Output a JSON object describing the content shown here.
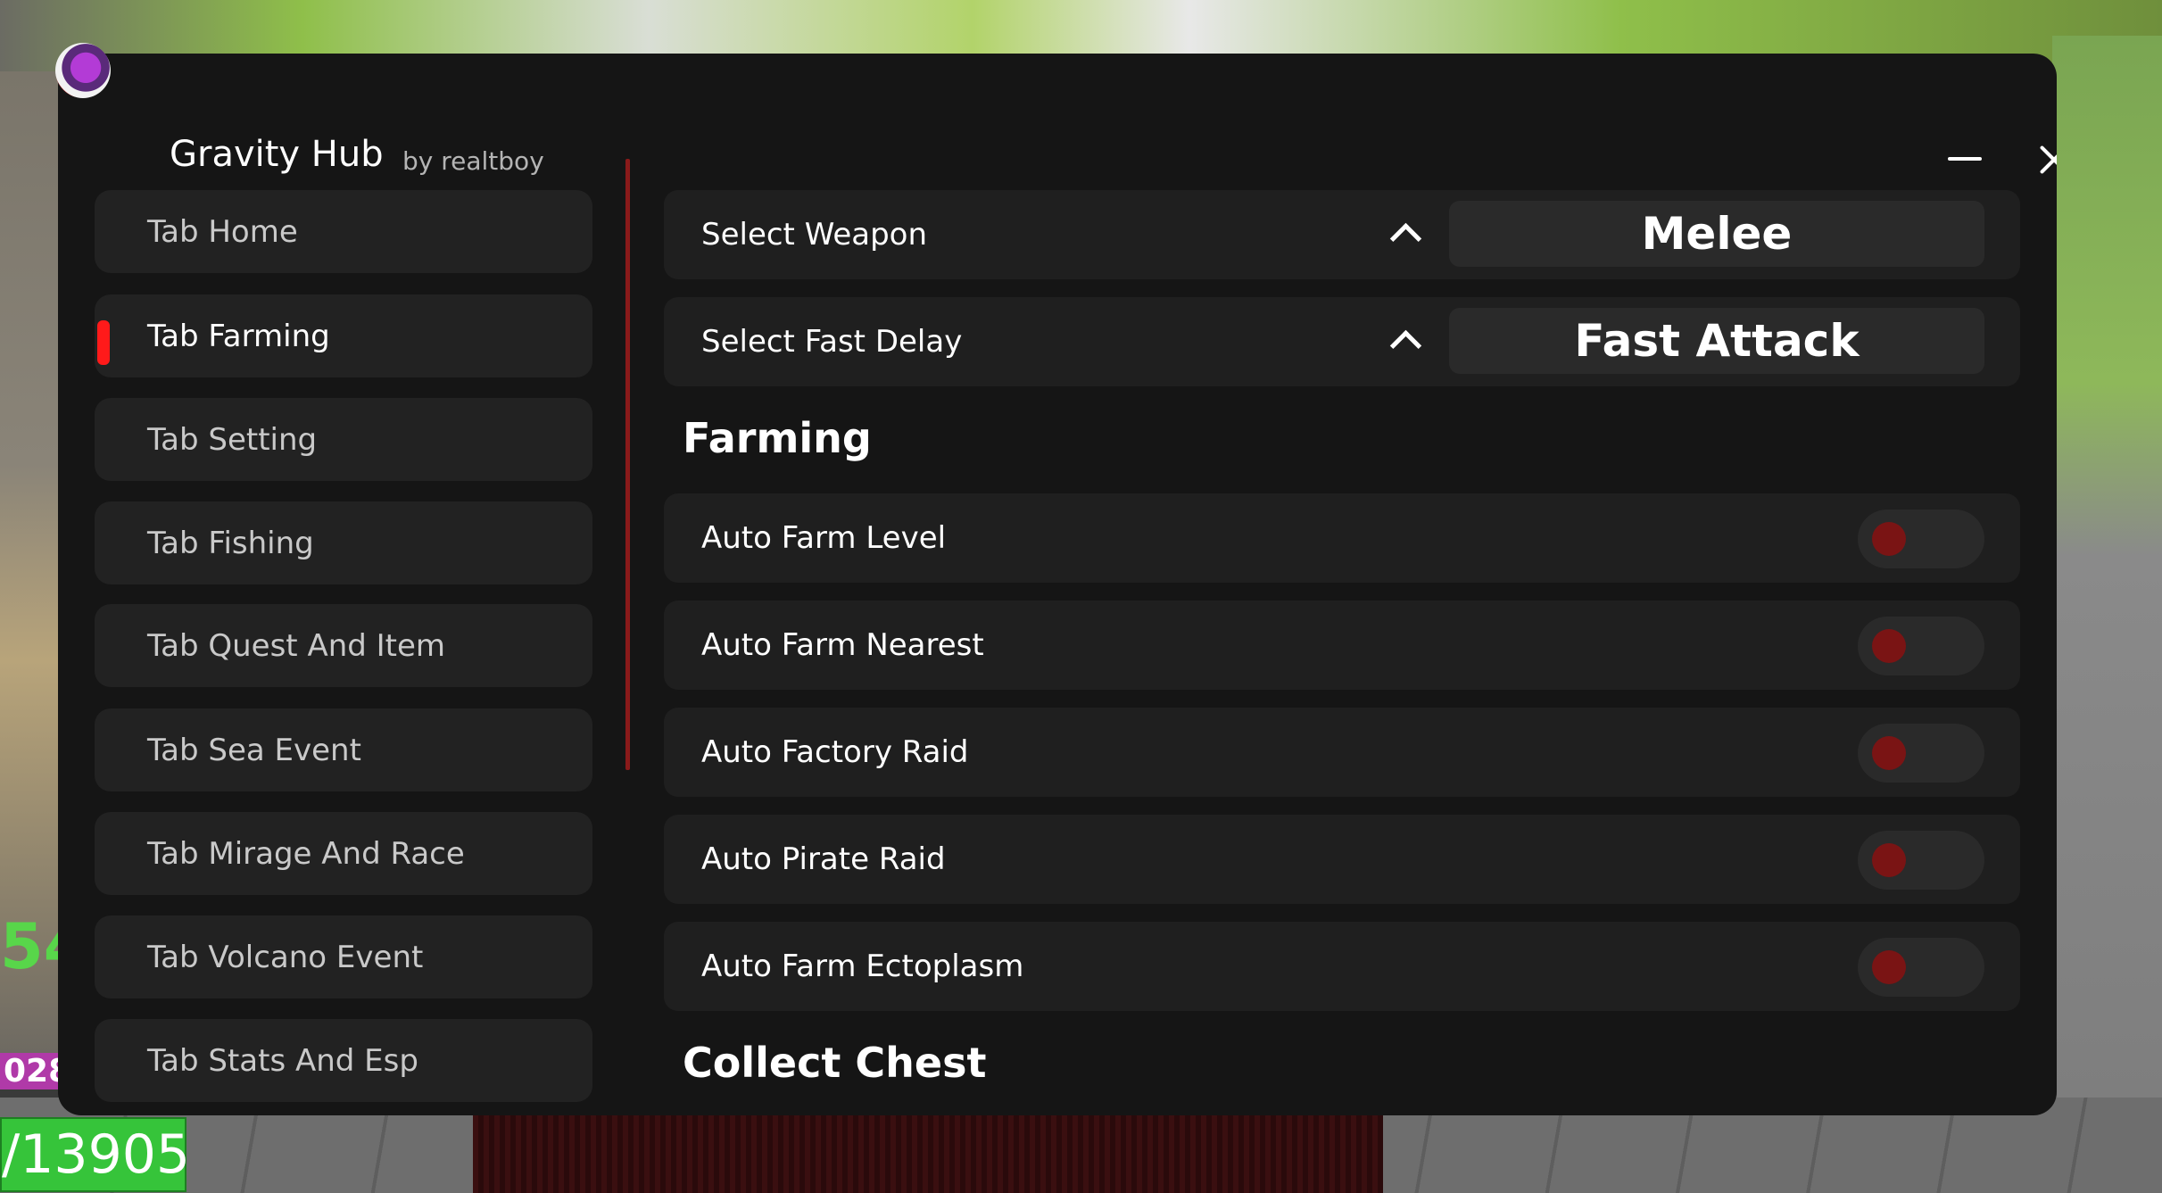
{
  "app": {
    "title": "Gravity Hub",
    "subtitle": "by realtboy"
  },
  "window_controls": {
    "minimize_icon": "minimize-icon",
    "close_icon": "close-icon"
  },
  "sidebar": {
    "items": [
      {
        "label": "Tab Home",
        "active": false
      },
      {
        "label": "Tab Farming",
        "active": true
      },
      {
        "label": "Tab Setting",
        "active": false
      },
      {
        "label": "Tab Fishing",
        "active": false
      },
      {
        "label": "Tab Quest And Item",
        "active": false
      },
      {
        "label": "Tab Sea Event",
        "active": false
      },
      {
        "label": "Tab Mirage And Race",
        "active": false
      },
      {
        "label": "Tab Volcano Event",
        "active": false
      },
      {
        "label": "Tab Stats And Esp",
        "active": false
      }
    ]
  },
  "dropdowns": [
    {
      "label": "Select Weapon",
      "value": "Melee"
    },
    {
      "label": "Select Fast Delay",
      "value": "Fast Attack"
    }
  ],
  "sections": [
    {
      "title": "Farming",
      "toggles": [
        {
          "label": "Auto Farm Level",
          "on": false
        },
        {
          "label": "Auto Farm Nearest",
          "on": false
        },
        {
          "label": "Auto Factory Raid",
          "on": false
        },
        {
          "label": "Auto Pirate Raid",
          "on": false
        },
        {
          "label": "Auto Farm Ectoplasm",
          "on": false
        }
      ]
    },
    {
      "title": "Collect Chest",
      "toggles": []
    }
  ],
  "hud": {
    "number": "54",
    "sub": "028,",
    "bar": "/13905"
  },
  "colors": {
    "accent": "#ff1a1a",
    "window_bg": "#151515",
    "item_bg": "#222222",
    "toggle_off_knob": "#7a1414"
  }
}
